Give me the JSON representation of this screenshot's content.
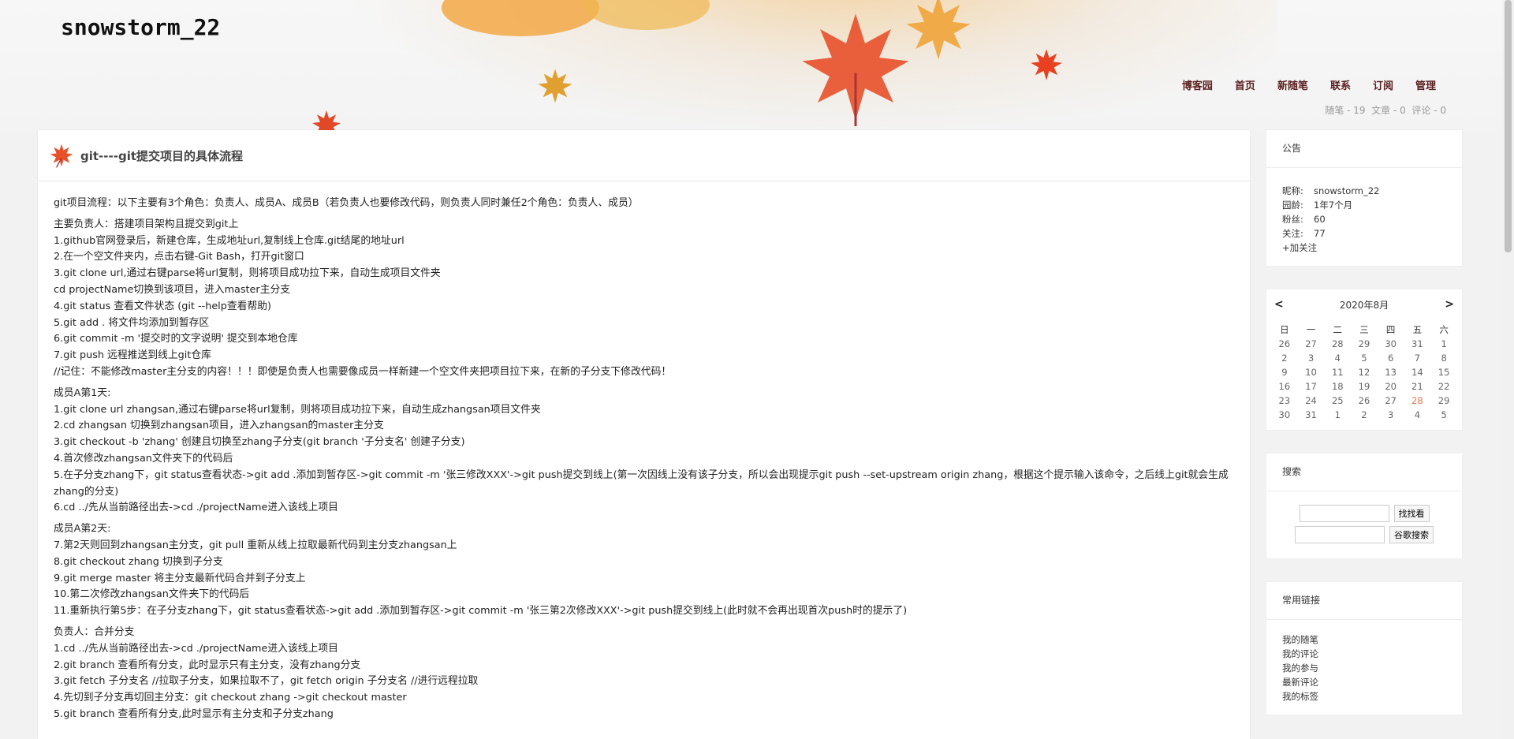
{
  "blog": {
    "title": "snowstorm_22"
  },
  "nav": [
    {
      "label": "博客园"
    },
    {
      "label": "首页"
    },
    {
      "label": "新随笔"
    },
    {
      "label": "联系"
    },
    {
      "label": "订阅"
    },
    {
      "label": "管理"
    }
  ],
  "stats": {
    "text": "随笔 - 19  文章 - 0  评论 - 0"
  },
  "post": {
    "title": "git----git提交项目的具体流程",
    "paragraphs": [
      [
        "git项目流程：以下主要有3个角色：负责人、成员A、成员B（若负责人也要修改代码，则负责人同时兼任2个角色：负责人、成员）"
      ],
      [
        "主要负责人：搭建项目架构且提交到git上",
        "1.github官网登录后，新建仓库，生成地址url,复制线上仓库.git结尾的地址url",
        "2.在一个空文件夹内，点击右键-Git Bash，打开git窗口",
        "3.git clone url,通过右键parse将url复制，则将项目成功拉下来，自动生成项目文件夹",
        "cd projectName切换到该项目，进入master主分支",
        "4.git status 查看文件状态 (git --help查看帮助)",
        "5.git add . 将文件均添加到暂存区",
        "6.git commit -m '提交时的文字说明' 提交到本地仓库",
        "7.git push 远程推送到线上git仓库",
        "//记住：不能修改master主分支的内容！！！即使是负责人也需要像成员一样新建一个空文件夹把项目拉下来，在新的子分支下修改代码！"
      ],
      [
        "成员A第1天:",
        "1.git clone url zhangsan,通过右键parse将url复制，则将项目成功拉下来，自动生成zhangsan项目文件夹",
        "2.cd zhangsan 切换到zhangsan项目，进入zhangsan的master主分支",
        "3.git checkout -b 'zhang' 创建且切换至zhang子分支(git branch '子分支名' 创建子分支)",
        "4.首次修改zhangsan文件夹下的代码后",
        "5.在子分支zhang下，git status查看状态->git add .添加到暂存区->git commit -m '张三修改XXX'->git push提交到线上(第一次因线上没有该子分支，所以会出现提示git push --set-upstream origin zhang，根据这个提示输入该命令，之后线上git就会生成zhang的分支)",
        "6.cd ../先从当前路径出去->cd ./projectName进入该线上项目"
      ],
      [
        "成员A第2天:",
        "7.第2天则回到zhangsan主分支，git pull 重新从线上拉取最新代码到主分支zhangsan上",
        "8.git checkout zhang 切换到子分支",
        "9.git merge master 将主分支最新代码合并到子分支上",
        "10.第二次修改zhangsan文件夹下的代码后",
        "11.重新执行第5步：在子分支zhang下，git status查看状态->git add .添加到暂存区->git commit -m '张三第2次修改XXX'->git push提交到线上(此时就不会再出现首次push时的提示了)"
      ],
      [
        "负责人：合并分支",
        "1.cd ../先从当前路径出去->cd ./projectName进入该线上项目",
        "2.git branch 查看所有分支，此时显示只有主分支，没有zhang分支",
        "3.git fetch 子分支名    //拉取子分支，如果拉取不了，git fetch origin 子分支名  //进行远程拉取",
        "4.先切到子分支再切回主分支：git checkout zhang ->git checkout master",
        "5.git branch 查看所有分支,此时显示有主分支和子分支zhang"
      ]
    ]
  },
  "sidebar": {
    "notice": {
      "title": "公告",
      "rows": [
        {
          "k": "昵称:",
          "v": "snowstorm_22"
        },
        {
          "k": "园龄:",
          "v": "1年7个月"
        },
        {
          "k": "粉丝:",
          "v": "60"
        },
        {
          "k": "关注:",
          "v": "77"
        }
      ],
      "follow_label": "+加关注"
    },
    "calendar": {
      "prev": "<",
      "next": ">",
      "month": "2020年8月",
      "weekdays": [
        "日",
        "一",
        "二",
        "三",
        "四",
        "五",
        "六"
      ],
      "weeks": [
        [
          "26",
          "27",
          "28",
          "29",
          "30",
          "31",
          "1"
        ],
        [
          "2",
          "3",
          "4",
          "5",
          "6",
          "7",
          "8"
        ],
        [
          "9",
          "10",
          "11",
          "12",
          "13",
          "14",
          "15"
        ],
        [
          "16",
          "17",
          "18",
          "19",
          "20",
          "21",
          "22"
        ],
        [
          "23",
          "24",
          "25",
          "26",
          "27",
          "28",
          "29"
        ],
        [
          "30",
          "31",
          "1",
          "2",
          "3",
          "4",
          "5"
        ]
      ],
      "today": "28",
      "accent_color": "#e8734a"
    },
    "search": {
      "title": "搜索",
      "site_search_label": "找找看",
      "google_search_label": "谷歌搜索"
    },
    "links": {
      "title": "常用链接",
      "items": [
        "我的随笔",
        "我的评论",
        "我的参与",
        "最新评论",
        "我的标签"
      ]
    }
  },
  "colors": {
    "nav_text": "#5a1e1e",
    "page_bg": "#f2f2f2"
  }
}
